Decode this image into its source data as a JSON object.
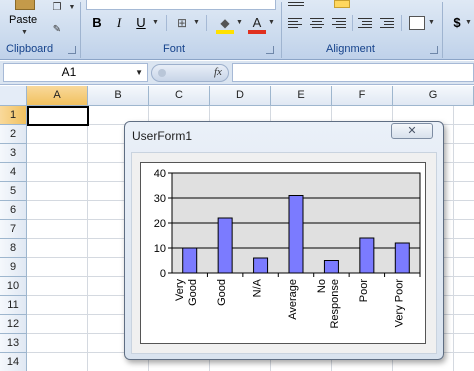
{
  "ribbon": {
    "clipboard": {
      "paste_label": "Paste",
      "group_label": "Clipboard"
    },
    "font": {
      "group_label": "Font",
      "bold": "B",
      "italic": "I",
      "underline": "U",
      "font_color_glyph": "A"
    },
    "alignment": {
      "group_label": "Alignment"
    },
    "number": {
      "currency_glyph": "$"
    }
  },
  "formula_bar": {
    "name_box_value": "A1",
    "fx_label": "fx",
    "formula_value": ""
  },
  "grid": {
    "columns": [
      "A",
      "B",
      "C",
      "D",
      "E",
      "F",
      "G"
    ],
    "rows": [
      "1",
      "2",
      "3",
      "4",
      "5",
      "6",
      "7",
      "8",
      "9",
      "10",
      "11",
      "12",
      "13",
      "14"
    ],
    "selected_cell": "A1"
  },
  "userform": {
    "title": "UserForm1",
    "close_glyph": "✕"
  },
  "chart_data": {
    "type": "bar",
    "categories": [
      "Very Good",
      "Good",
      "N/A",
      "Average",
      "No Response",
      "Poor",
      "Very Poor"
    ],
    "category_lines": [
      [
        "Very",
        "Good"
      ],
      [
        "Good"
      ],
      [
        "N/A"
      ],
      [
        "Average"
      ],
      [
        "No",
        "Response"
      ],
      [
        "Poor"
      ],
      [
        "Very Poor"
      ]
    ],
    "values": [
      10,
      22,
      6,
      31,
      5,
      14,
      12
    ],
    "ylim": [
      0,
      40
    ],
    "yticks": [
      "0",
      "10",
      "20",
      "30",
      "40"
    ],
    "grid": true,
    "bar_color": "#7b7bff",
    "plot_background": "#e0e0e0"
  },
  "colors": {
    "ribbon_text": "#15428b",
    "fill_yellow": "#ffe100",
    "font_red": "#e0301e"
  }
}
